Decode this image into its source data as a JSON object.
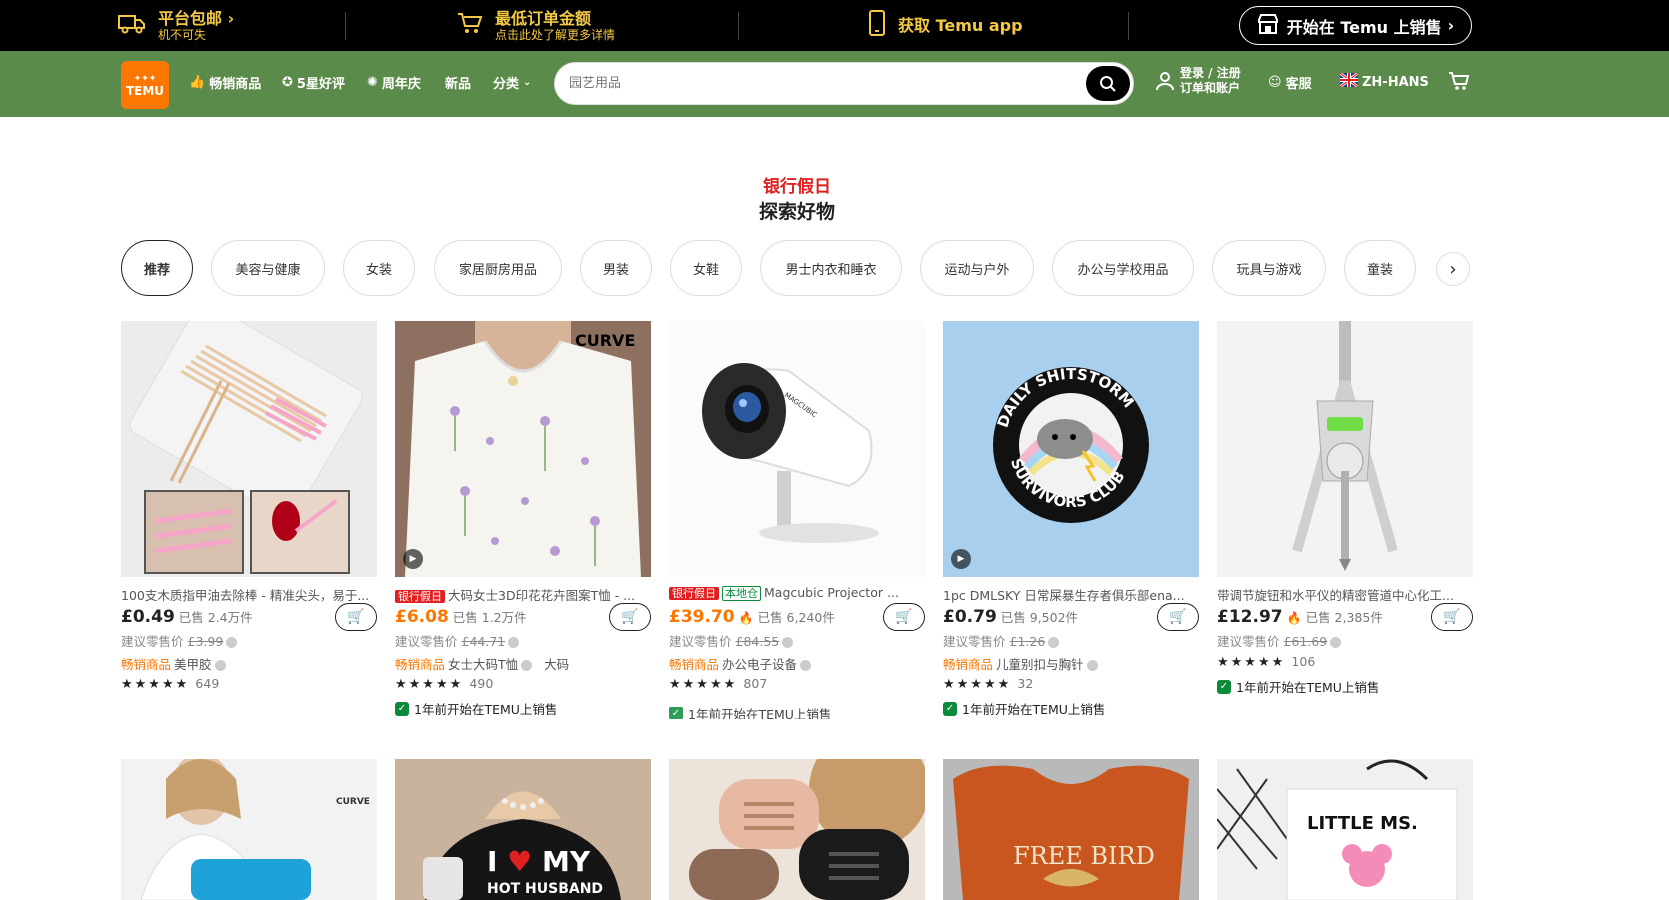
{
  "promo": {
    "shipping_title": "平台包邮",
    "shipping_sub": "机不可失",
    "order_title": "最低订单金额",
    "order_sub": "点击此处了解更多详情",
    "app_label": "获取 Temu app",
    "sell_label": "开始在 Temu 上销售"
  },
  "nav": {
    "logo_line1": "TEMU",
    "items": [
      "畅销商品",
      "5星好评",
      "周年庆",
      "新品",
      "分类"
    ],
    "search_placeholder": "园艺用品",
    "login_line1": "登录 / 注册",
    "login_line2": "订单和账户",
    "service": "客服",
    "language": "ZH-HANS"
  },
  "heading": {
    "sub": "银行假日",
    "main": "探索好物"
  },
  "chips": [
    "推荐",
    "美容与健康",
    "女装",
    "家居厨房用品",
    "男装",
    "女鞋",
    "男士内衣和睡衣",
    "运动与户外",
    "办公与学校用品",
    "玩具与游戏",
    "童装"
  ],
  "products": [
    {
      "title": "100支木质指甲油去除棒 - 精准尖头，易于...",
      "badges": [],
      "price": "£0.49",
      "sold": "已售 2.4万件",
      "rrp_label": "建议零售价",
      "rrp": "£3.99",
      "hot": "畅销商品",
      "category": "美甲胶",
      "rating": "★★★★★",
      "reviews": "649",
      "since": ""
    },
    {
      "title": "大码女士3D印花花卉图案T恤 - ...",
      "badges": [
        "银行假日"
      ],
      "price": "£6.08",
      "sold": "已售 1.2万件",
      "rrp_label": "建议零售价",
      "rrp": "£44.71",
      "hot": "畅销商品",
      "category": "女士大码T恤",
      "category_extra": "大码",
      "rating": "★★★★★",
      "reviews": "490",
      "since": "1年前开始在TEMU上销售"
    },
    {
      "title": "Magcubic Projector ...",
      "badges": [
        "银行假日",
        "本地仓"
      ],
      "price": "£39.70",
      "sold": "已售 6,240件",
      "rrp_label": "建议零售价",
      "rrp": "£84.55",
      "hot": "畅销商品",
      "category": "办公电子设备",
      "rating": "★★★★★",
      "reviews": "807",
      "since": "1年前开始在TEMU上销售"
    },
    {
      "title": "1pc DMLSKY 日常屎暴生存者俱乐部ena...",
      "badges": [],
      "price": "£0.79",
      "sold": "已售 9,502件",
      "rrp_label": "建议零售价",
      "rrp": "£1.26",
      "hot": "畅销商品",
      "category": "儿童别扣与胸针",
      "rating": "★★★★★",
      "reviews": "32",
      "since": "1年前开始在TEMU上销售"
    },
    {
      "title": "带调节旋钮和水平仪的精密管道中心化工...",
      "badges": [],
      "price": "£12.97",
      "sold": "已售 2,385件",
      "rrp_label": "建议零售价",
      "rrp": "£61.69",
      "hot": "",
      "category": "",
      "rating": "★★★★★",
      "reviews": "106",
      "since": "1年前开始在TEMU上销售"
    }
  ],
  "row2_images": [
    "CURVE",
    "I ♥ MY HOT HUSBAND",
    "",
    "FREE BIRD",
    "LITTLE MS."
  ],
  "image_texts": {
    "curve": "CURVE",
    "pin_top": "DAILY SHITSTORM",
    "pin_bottom": "SURVIVORS CLUB",
    "projector": "MAGCUBIC"
  },
  "colors": {
    "promo_bg": "#000000",
    "promo_text": "#f3c845",
    "nav_bg": "#5b8b4a",
    "brand": "#fb7701",
    "sale_red": "#e02020",
    "green": "#0a8a3a"
  }
}
